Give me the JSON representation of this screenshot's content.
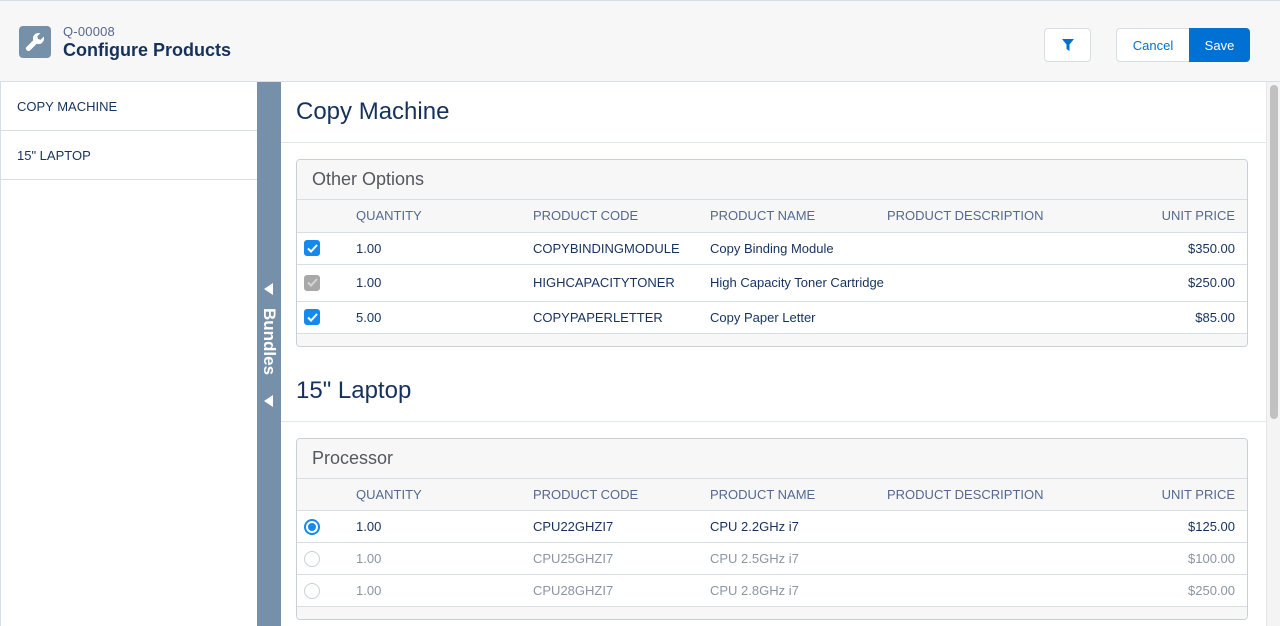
{
  "header": {
    "record_id": "Q-00008",
    "title": "Configure Products",
    "app_icon": "wrench-icon",
    "filter_icon": "filter-icon",
    "cancel_label": "Cancel",
    "save_label": "Save"
  },
  "colors": {
    "brand": "#0070d2",
    "checkbox": "#1589ee",
    "bundles_bar": "#7590a8"
  },
  "sidebar": {
    "items": [
      {
        "label": "COPY MACHINE"
      },
      {
        "label": "15\" LAPTOP"
      }
    ]
  },
  "bundles_bar": {
    "label": "Bundles"
  },
  "columns": {
    "quantity": "QUANTITY",
    "product_code": "PRODUCT CODE",
    "product_name": "PRODUCT NAME",
    "product_description": "PRODUCT DESCRIPTION",
    "unit_price": "UNIT PRICE"
  },
  "sections": [
    {
      "title": "Copy Machine",
      "feature": "Other Options",
      "selection": "checkbox",
      "rows": [
        {
          "selected": true,
          "disabled": false,
          "quantity": "1.00",
          "product_code": "COPYBINDINGMODULE",
          "product_name": "Copy Binding Module",
          "product_description": "",
          "unit_price": "$350.00"
        },
        {
          "selected": true,
          "disabled": true,
          "quantity": "1.00",
          "product_code": "HIGHCAPACITYTONER",
          "product_name": "High Capacity Toner Cartridge",
          "product_description": "",
          "unit_price": "$250.00"
        },
        {
          "selected": true,
          "disabled": false,
          "quantity": "5.00",
          "product_code": "COPYPAPERLETTER",
          "product_name": "Copy Paper Letter",
          "product_description": "",
          "unit_price": "$85.00"
        }
      ]
    },
    {
      "title": "15\" Laptop",
      "feature": "Processor",
      "selection": "radio",
      "rows": [
        {
          "selected": true,
          "quantity": "1.00",
          "product_code": "CPU22GHZI7",
          "product_name": "CPU 2.2GHz i7",
          "product_description": "",
          "unit_price": "$125.00"
        },
        {
          "selected": false,
          "quantity": "1.00",
          "product_code": "CPU25GHZI7",
          "product_name": "CPU 2.5GHz i7",
          "product_description": "",
          "unit_price": "$100.00"
        },
        {
          "selected": false,
          "quantity": "1.00",
          "product_code": "CPU28GHZI7",
          "product_name": "CPU 2.8GHz i7",
          "product_description": "",
          "unit_price": "$250.00"
        }
      ]
    }
  ]
}
